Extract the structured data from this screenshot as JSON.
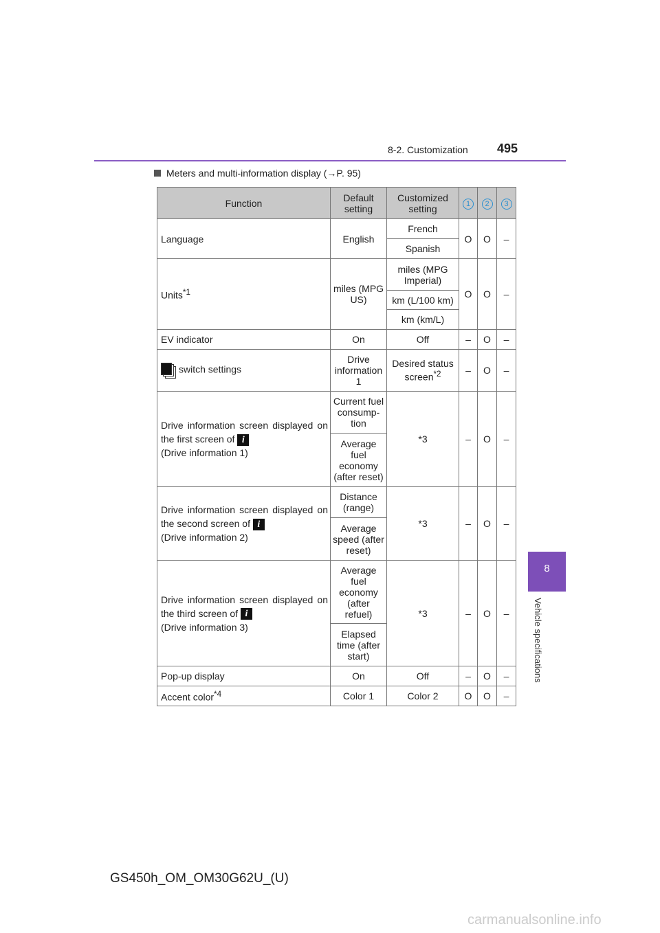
{
  "header": {
    "section": "8-2. Customization",
    "page_number": "495"
  },
  "section_title": "Meters and multi-information display (→P. 95)",
  "table": {
    "headers": {
      "function": "Function",
      "default": "Default setting",
      "customized": "Customized setting",
      "c1": "1",
      "c2": "2",
      "c3": "3"
    },
    "mark_circle": "O",
    "mark_dash": "–",
    "language": {
      "function": "Language",
      "default": "English",
      "options": [
        "French",
        "Spanish"
      ]
    },
    "units": {
      "function": "Units",
      "note": "*1",
      "default": "miles (MPG US)",
      "options": [
        "miles (MPG Imperial)",
        "km (L/100 km)",
        "km (km/L)"
      ]
    },
    "ev": {
      "function": "EV indicator",
      "default": "On",
      "custom": "Off"
    },
    "switch": {
      "function": "switch settings",
      "default": "Drive information 1",
      "custom": "Desired status screen",
      "note": "*2"
    },
    "drive1": {
      "function": "Drive information screen displayed on the first screen of",
      "sub": "(Drive information 1)",
      "defaults": [
        "Current fuel consump-tion",
        "Average fuel economy (after reset)"
      ],
      "custom": "*3"
    },
    "drive2": {
      "function": "Drive information screen displayed on the second screen of",
      "sub": "(Drive information 2)",
      "defaults": [
        "Distance (range)",
        "Average speed (after reset)"
      ],
      "custom": "*3"
    },
    "drive3": {
      "function": "Drive information screen displayed on the third screen of",
      "sub": "(Drive information 3)",
      "defaults": [
        "Average fuel economy (after refuel)",
        "Elapsed time (after start)"
      ],
      "custom": "*3"
    },
    "popup": {
      "function": "Pop-up display",
      "default": "On",
      "custom": "Off"
    },
    "accent": {
      "function": "Accent color",
      "note": "*4",
      "default": "Color 1",
      "custom": "Color 2"
    },
    "info_icon_letter": "i"
  },
  "side_tab": {
    "number": "8",
    "label": "Vehicle specifications",
    "color": "#7d4fb8"
  },
  "footer": "GS450h_OM_OM30G62U_(U)",
  "watermark": "carmanualsonline.info"
}
